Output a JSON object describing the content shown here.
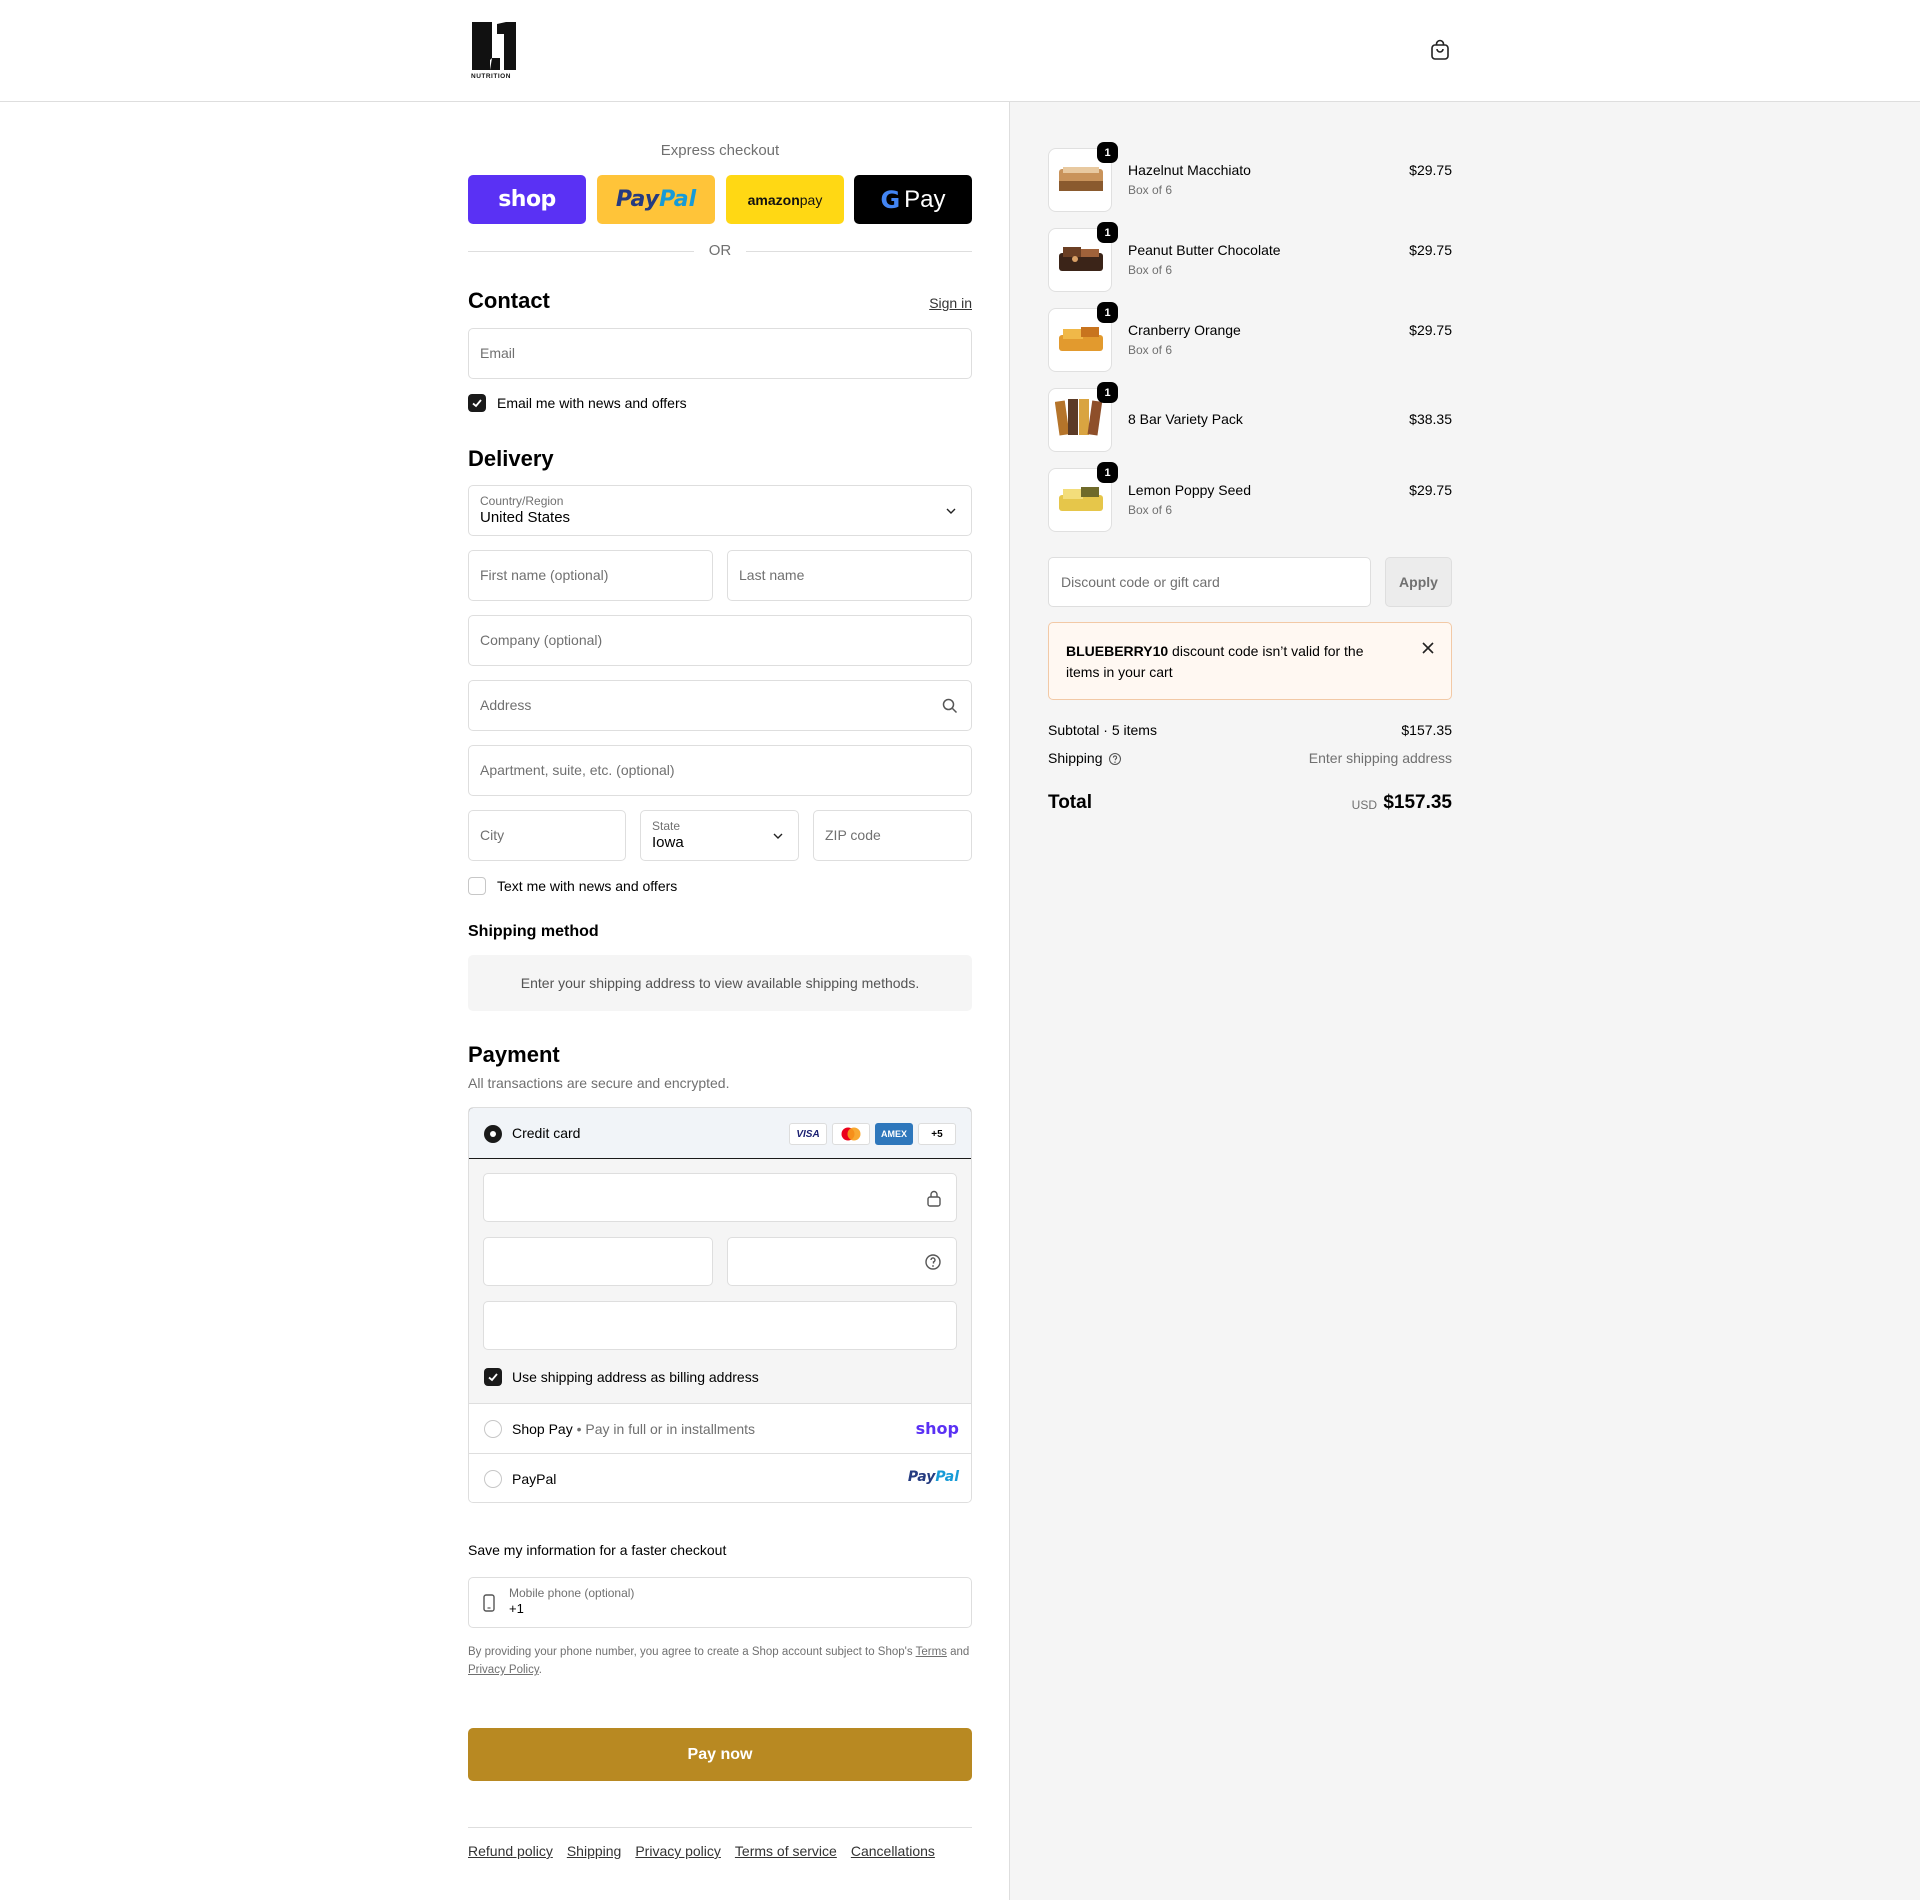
{
  "header": {
    "logo_text": "NUTRITION"
  },
  "express": {
    "title": "Express checkout",
    "shop_label": "shop",
    "paypal_label_1": "Pay",
    "paypal_label_2": "Pal",
    "amazon_label_1": "amazon",
    "amazon_label_2": " pay",
    "gpay_g": "G",
    "gpay_label": "Pay",
    "or": "OR"
  },
  "contact": {
    "title": "Contact",
    "sign_in": "Sign in",
    "email_placeholder": "Email",
    "news_checkbox": "Email me with news and offers"
  },
  "delivery": {
    "title": "Delivery",
    "country_label": "Country/Region",
    "country_value": "United States",
    "first_name": "First name (optional)",
    "last_name": "Last name",
    "company": "Company (optional)",
    "address": "Address",
    "apartment": "Apartment, suite, etc. (optional)",
    "city": "City",
    "state_label": "State",
    "state_value": "Iowa",
    "zip": "ZIP code",
    "text_checkbox": "Text me with news and offers"
  },
  "shipping_method": {
    "title": "Shipping method",
    "message": "Enter your shipping address to view available shipping methods."
  },
  "payment": {
    "title": "Payment",
    "subtitle": "All transactions are secure and encrypted.",
    "credit_card": "Credit card",
    "badges": [
      "VISA",
      "",
      "AMEX",
      "+5"
    ],
    "billing_checkbox": "Use shipping address as billing address",
    "shop_pay": "Shop Pay",
    "shop_pay_sub": "Pay in full or in installments",
    "shop_pay_brand": "shop",
    "paypal": "PayPal",
    "paypal_brand_1": "Pay",
    "paypal_brand_2": "Pal"
  },
  "save_info": {
    "title": "Save my information for a faster checkout",
    "phone_label": "Mobile phone (optional)",
    "phone_value": "+1",
    "legal_1": "By providing your phone number, you agree to create a Shop account subject to Shop's ",
    "legal_terms": "Terms",
    "legal_2": " and ",
    "legal_privacy": "Privacy Policy",
    "legal_3": "."
  },
  "pay_now": "Pay now",
  "footer": {
    "links": [
      "Refund policy",
      "Shipping",
      "Privacy policy",
      "Terms of service",
      "Cancellations"
    ]
  },
  "order": {
    "items": [
      {
        "name": "Hazelnut Macchiato",
        "variant": "Box of 6",
        "price": "$29.75",
        "qty": "1"
      },
      {
        "name": "Peanut Butter Chocolate",
        "variant": "Box of 6",
        "price": "$29.75",
        "qty": "1"
      },
      {
        "name": "Cranberry Orange",
        "variant": "Box of 6",
        "price": "$29.75",
        "qty": "1"
      },
      {
        "name": "8 Bar Variety Pack",
        "variant": "",
        "price": "$38.35",
        "qty": "1"
      },
      {
        "name": "Lemon Poppy Seed",
        "variant": "Box of 6",
        "price": "$29.75",
        "qty": "1"
      }
    ],
    "discount_placeholder": "Discount code or gift card",
    "apply": "Apply",
    "alert_code": "BLUEBERRY10",
    "alert_msg": " discount code isn’t valid for the items in your cart",
    "subtotal_label": "Subtotal · 5 items",
    "subtotal_value": "$157.35",
    "shipping_label": "Shipping",
    "shipping_value": "Enter shipping address",
    "total_label": "Total",
    "currency": "USD",
    "total_value": "$157.35"
  }
}
